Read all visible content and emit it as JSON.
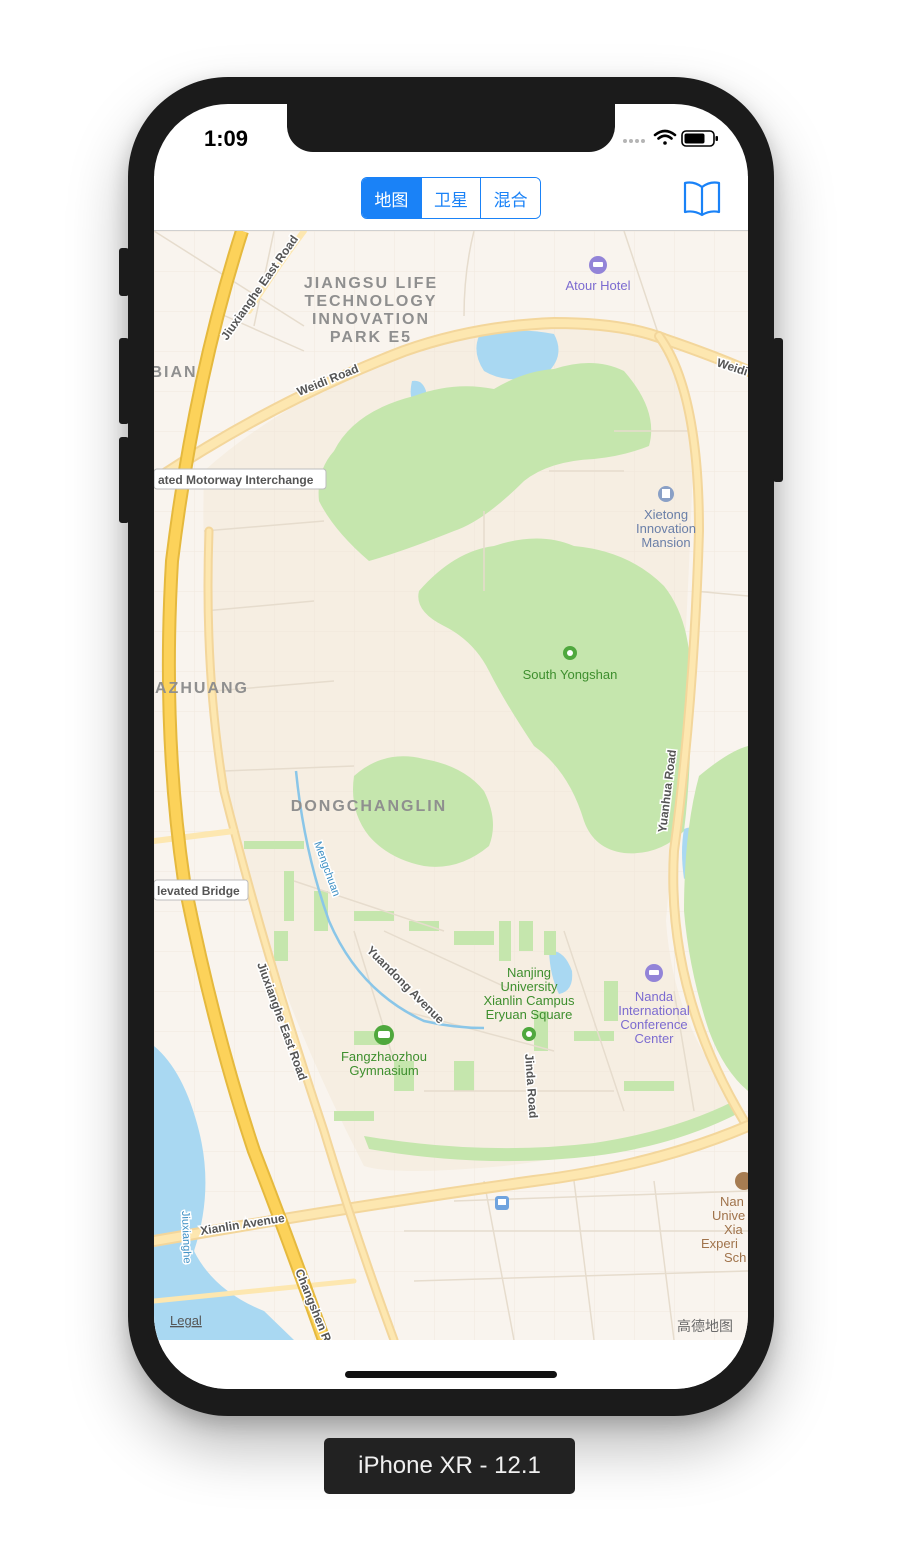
{
  "status_bar": {
    "time": "1:09"
  },
  "segmented_control": {
    "items": [
      "地图",
      "卫星",
      "混合"
    ],
    "selected": "地图"
  },
  "nav_right_icon": "book-icon",
  "colors": {
    "accent": "#1a82f7",
    "land": "#f9f4ee",
    "park": "#c5e6ad",
    "water": "#a9d8f2",
    "motorway": "#fcd25a",
    "major_road": "#fde7b0",
    "building": "#f6eee2",
    "poi_green": "#4fa83d",
    "poi_purple": "#9384d8"
  },
  "map": {
    "district_labels": {
      "jiangsu_life": [
        "JIANGSU LIFE",
        "TECHNOLOGY",
        "INNOVATION",
        "PARK E5"
      ],
      "bian": "BIAN",
      "azhuang": "AZHUANG",
      "dongchanglin": "DONGCHANGLIN"
    },
    "road_labels": {
      "jiuxianghe_north": "Jiuxianghe East Road",
      "weidi_west": "Weidi Road",
      "weidi_east": "Weidi",
      "yuanhua": "Yuanhua Road",
      "jiuxianghe_south": "Jiuxianghe East Road",
      "xianlin": "Xianlin Avenue",
      "changshen": "Changshen R",
      "jinda": "Jinda Road",
      "yuandong": "Yuandong Avenue",
      "mengchuan": "Mengchuan",
      "jiuxianghe_river": "Jiuxianghe"
    },
    "callouts": {
      "motorway": "ated Motorway Interchange",
      "bridge": "levated Bridge"
    },
    "pois": {
      "atour": "Atour Hotel",
      "xietong": [
        "Xietong",
        "Innovation",
        "Mansion"
      ],
      "south_yongshan": "South Yongshan",
      "nanjing_university": [
        "Nanjing",
        "University",
        "Xianlin Campus",
        "Eryuan Square"
      ],
      "nanda": [
        "Nanda",
        "International",
        "Conference",
        "Center"
      ],
      "fangzhaozhou": [
        "Fangzhaozhou",
        "Gymnasium"
      ],
      "nanjing_school": [
        "Nan",
        "Unive",
        "Xia",
        "Experi",
        "Sch"
      ]
    },
    "legal": "Legal",
    "attribution": "高德地图"
  },
  "device_label": "iPhone XR - 12.1"
}
